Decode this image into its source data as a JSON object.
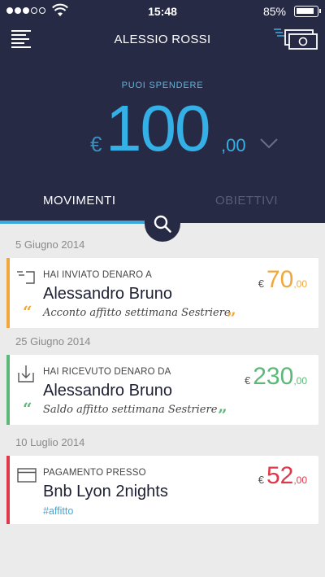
{
  "status_bar": {
    "time": "15:48",
    "battery": "85%"
  },
  "header": {
    "user_name": "ALESSIO ROSSI"
  },
  "balance": {
    "label": "PUOI SPENDERE",
    "currency": "€",
    "integer": "100",
    "decimals": ",00"
  },
  "tabs": [
    {
      "label": "MOVIMENTI",
      "active": true
    },
    {
      "label": "OBIETTIVI",
      "active": false
    }
  ],
  "transactions": [
    {
      "date": "5 Giugno 2014",
      "kind": "HAI INVIATO DENARO A",
      "counterparty": "Alessandro Bruno",
      "note": "Acconto affitto settimana Sestriere",
      "currency": "€",
      "amount_int": "70",
      "amount_dec": ",00",
      "color": "#f0a83e",
      "icon": "send-money-icon"
    },
    {
      "date": "25 Giugno 2014",
      "kind": "HAI RICEVUTO DENARO DA",
      "counterparty": "Alessandro Bruno",
      "note": "Saldo affitto settimana Sestriere",
      "currency": "€",
      "amount_int": "230",
      "amount_dec": ",00",
      "color": "#5cb878",
      "icon": "receive-money-icon"
    },
    {
      "date": "10 Luglio 2014",
      "kind": "PAGAMENTO PRESSO",
      "counterparty": "Bnb Lyon 2nights",
      "tag": "#affitto",
      "currency": "€",
      "amount_int": "52",
      "amount_dec": ",00",
      "color": "#e0384b",
      "icon": "card-payment-icon"
    }
  ],
  "colors": {
    "header_bg": "#272a45",
    "accent": "#3aa9dd",
    "list_bg": "#ebebeb"
  }
}
